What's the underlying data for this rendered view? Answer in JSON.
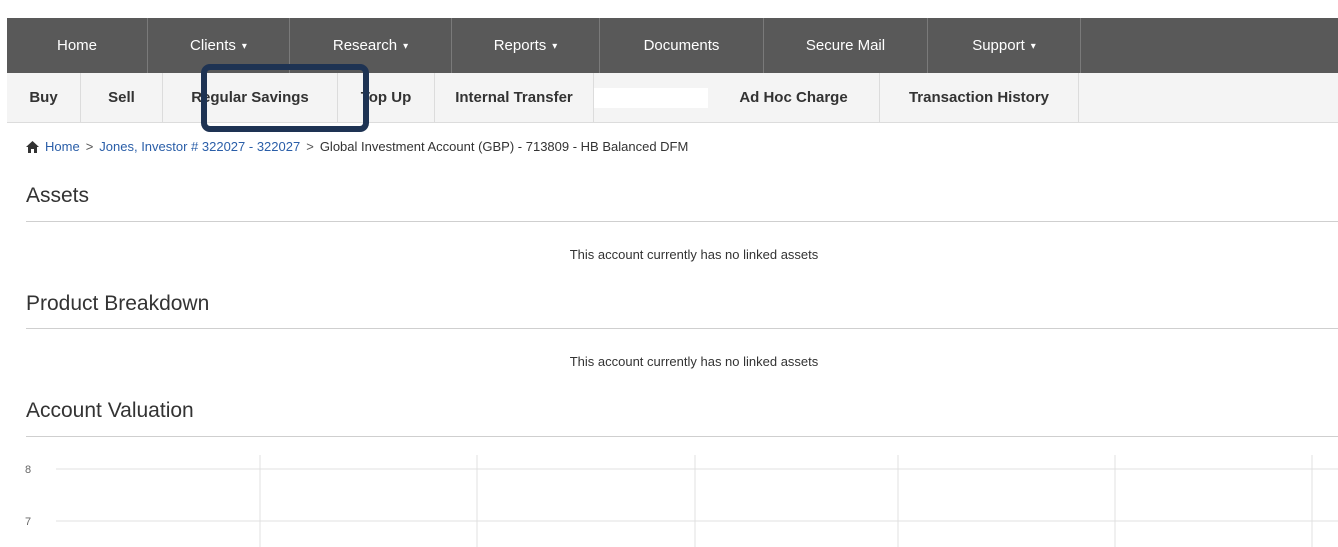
{
  "top_nav": [
    {
      "label": "Home",
      "has_caret": false
    },
    {
      "label": "Clients",
      "has_caret": true
    },
    {
      "label": "Research",
      "has_caret": true
    },
    {
      "label": "Reports",
      "has_caret": true
    },
    {
      "label": "Documents",
      "has_caret": false
    },
    {
      "label": "Secure Mail",
      "has_caret": false
    },
    {
      "label": "Support",
      "has_caret": true
    }
  ],
  "sub_nav": [
    {
      "label": "Buy"
    },
    {
      "label": "Sell"
    },
    {
      "label": "Regular Savings"
    },
    {
      "label": "Top Up"
    },
    {
      "label": "Internal Transfer"
    },
    {
      "label": ""
    },
    {
      "label": "Ad Hoc Charge"
    },
    {
      "label": "Transaction History"
    }
  ],
  "caret_glyph": "▾",
  "breadcrumb": {
    "home": "Home",
    "separator": ">",
    "client": "Jones, Investor # 322027 - 322027",
    "current": "Global Investment Account (GBP) - 713809 - HB Balanced DFM"
  },
  "sections": {
    "assets": {
      "title": "Assets",
      "empty_message": "This account currently has no linked assets"
    },
    "product_breakdown": {
      "title": "Product Breakdown",
      "empty_message": "This account currently has no linked assets"
    },
    "account_valuation": {
      "title": "Account Valuation"
    }
  },
  "colors": {
    "top_nav_bg": "#595959",
    "sub_nav_bg": "#f4f4f4",
    "highlight_border": "#1e3353",
    "link": "#2a5ea8"
  },
  "chart_data": {
    "type": "line",
    "y_ticks": [
      8,
      7
    ],
    "series": [],
    "grid": true
  }
}
